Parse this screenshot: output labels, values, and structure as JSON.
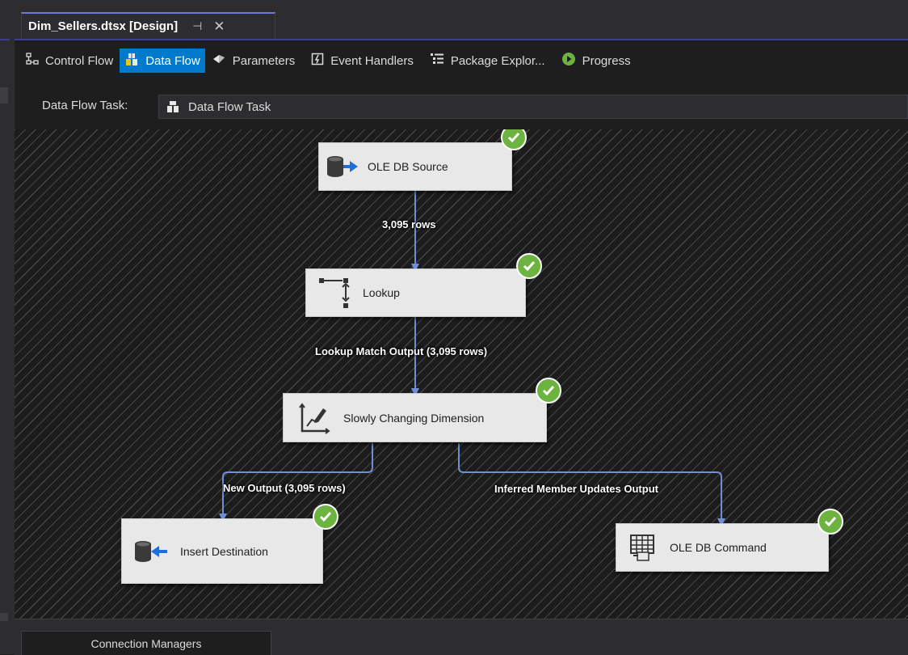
{
  "document_tab": {
    "title": "Dim_Sellers.dtsx [Design]",
    "pin_glyph": "⊣",
    "close_glyph": "✕"
  },
  "designer_tabs": [
    {
      "label": "Control Flow",
      "icon": "control-flow-icon",
      "active": false
    },
    {
      "label": "Data Flow",
      "icon": "data-flow-icon",
      "active": true
    },
    {
      "label": "Parameters",
      "icon": "parameters-icon",
      "active": false
    },
    {
      "label": "Event Handlers",
      "icon": "event-handlers-icon",
      "active": false
    },
    {
      "label": "Package Explor...",
      "icon": "package-explorer-icon",
      "active": false
    },
    {
      "label": "Progress",
      "icon": "progress-icon",
      "active": false
    }
  ],
  "data_flow_task": {
    "label": "Data Flow Task:",
    "selected": "Data Flow Task"
  },
  "components": {
    "ole_db_source": {
      "label": "OLE DB Source",
      "icon": "database-source-icon",
      "status": "success"
    },
    "lookup": {
      "label": "Lookup",
      "icon": "lookup-icon",
      "status": "success"
    },
    "scd": {
      "label": "Slowly Changing Dimension",
      "icon": "slowly-changing-dimension-icon",
      "status": "success"
    },
    "insert_destination": {
      "label": "Insert Destination",
      "icon": "database-destination-icon",
      "status": "success"
    },
    "ole_db_command": {
      "label": "OLE DB Command",
      "icon": "ole-db-command-icon",
      "status": "success"
    }
  },
  "paths": {
    "source_to_lookup": "3,095 rows",
    "lookup_to_scd": "Lookup Match Output (3,095 rows)",
    "scd_to_insert": "New Output (3,095 rows)",
    "scd_to_command": "Inferred Member Updates Output"
  },
  "bottom": {
    "connection_managers": "Connection Managers"
  },
  "colors": {
    "accent": "#007acc",
    "success": "#6db33f",
    "path": "#6e8fd6",
    "tab_border": "#6b7bd7"
  }
}
